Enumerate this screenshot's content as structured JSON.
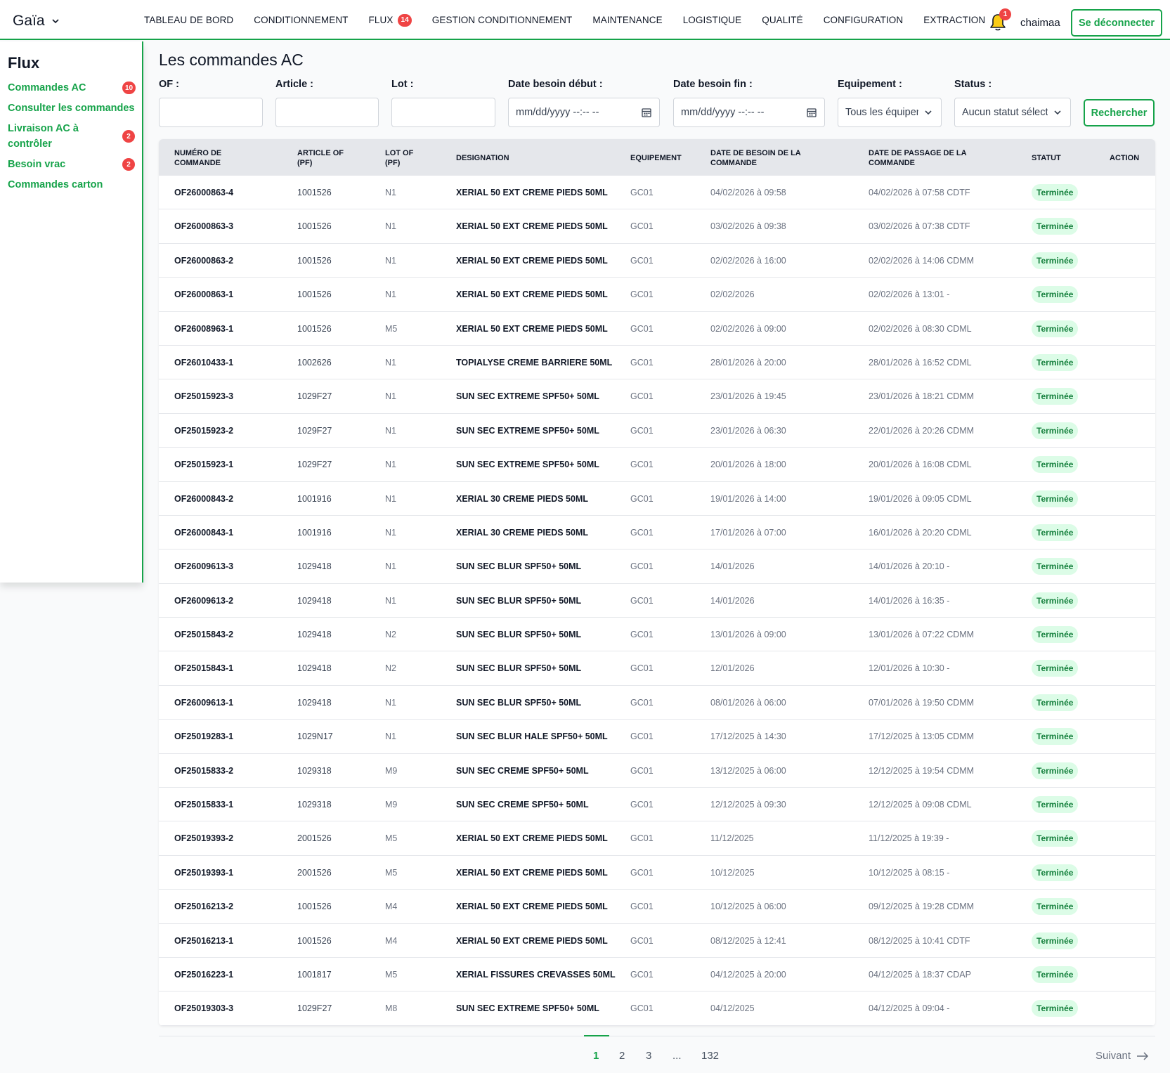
{
  "app": {
    "brand": "Gaïa"
  },
  "colors": {
    "accent": "#16a34a",
    "badge": "#ef4444",
    "status_bg": "#dcfce7",
    "status_text": "#15803d"
  },
  "nav": [
    {
      "label": "TABLEAU DE BORD"
    },
    {
      "label": "CONDITIONNEMENT"
    },
    {
      "label": "FLUX",
      "badge": "14"
    },
    {
      "label": "GESTION CONDITIONNEMENT"
    },
    {
      "label": "MAINTENANCE"
    },
    {
      "label": "LOGISTIQUE"
    },
    {
      "label": "QUALITÉ"
    },
    {
      "label": "CONFIGURATION"
    },
    {
      "label": "EXTRACTION"
    }
  ],
  "header": {
    "notification_icon": "bell-icon",
    "notifications_count": "1",
    "username": "chaimaa",
    "logout_label": "Se déconnecter"
  },
  "sidebar": {
    "title": "Flux",
    "items": [
      {
        "label": "Commandes AC",
        "badge": "10"
      },
      {
        "label": "Consulter les commandes",
        "badge": ""
      },
      {
        "label": "Livraison AC à contrôler",
        "badge": "2"
      },
      {
        "label": "Besoin vrac",
        "badge": "2"
      },
      {
        "label": "Commandes carton",
        "badge": ""
      }
    ]
  },
  "main": {
    "title": "Les commandes AC"
  },
  "filters": {
    "of_label": "OF :",
    "article_label": "Article :",
    "lot_label": "Lot :",
    "date_start_label": "Date besoin début :",
    "date_start_placeholder": "mm/dd/yyyy --:-- --",
    "date_end_label": "Date besoin fin :",
    "date_end_placeholder": "mm/dd/yyyy --:-- --",
    "equipment_label": "Equipement :",
    "equipment_value": "Tous les équipements",
    "status_label": "Status :",
    "status_value": "Aucun statut sélectionné",
    "search_label": "Rechercher"
  },
  "table": {
    "headers": {
      "num_l1": "NUMÉRO DE",
      "num_l2": "COMMANDE",
      "art_l1": "ARTICLE OF",
      "art_l2": "(PF)",
      "lot_l1": "LOT OF",
      "lot_l2": "(PF)",
      "des": "DESIGNATION",
      "eq": "EQUIPEMENT",
      "db_l1": "DATE DE BESOIN DE LA",
      "db_l2": "COMMANDE",
      "dp_l1": "DATE DE PASSAGE DE LA",
      "dp_l2": "COMMANDE",
      "status": "STATUT",
      "action": "ACTION"
    },
    "rows": [
      [
        "OF26000863-4",
        "1001526",
        "N1",
        "XERIAL 50 EXT CREME PIEDS 50ML",
        "GC01",
        "04/02/2026 à 09:58",
        "04/02/2026 à 07:58 CDTF",
        "Terminée"
      ],
      [
        "OF26000863-3",
        "1001526",
        "N1",
        "XERIAL 50 EXT CREME PIEDS 50ML",
        "GC01",
        "03/02/2026 à 09:38",
        "03/02/2026 à 07:38 CDTF",
        "Terminée"
      ],
      [
        "OF26000863-2",
        "1001526",
        "N1",
        "XERIAL 50 EXT CREME PIEDS 50ML",
        "GC01",
        "02/02/2026 à 16:00",
        "02/02/2026 à 14:06 CDMM",
        "Terminée"
      ],
      [
        "OF26000863-1",
        "1001526",
        "N1",
        "XERIAL 50 EXT CREME PIEDS 50ML",
        "GC01",
        "02/02/2026",
        "02/02/2026 à 13:01 -",
        "Terminée"
      ],
      [
        "OF26008963-1",
        "1001526",
        "M5",
        "XERIAL 50 EXT CREME PIEDS 50ML",
        "GC01",
        "02/02/2026 à 09:00",
        "02/02/2026 à 08:30 CDML",
        "Terminée"
      ],
      [
        "OF26010433-1",
        "1002626",
        "N1",
        "TOPIALYSE CREME BARRIERE 50ML",
        "GC01",
        "28/01/2026 à 20:00",
        "28/01/2026 à 16:52 CDML",
        "Terminée"
      ],
      [
        "OF25015923-3",
        "1029F27",
        "N1",
        "SUN SEC EXTREME SPF50+ 50ML",
        "GC01",
        "23/01/2026 à 19:45",
        "23/01/2026 à 18:21 CDMM",
        "Terminée"
      ],
      [
        "OF25015923-2",
        "1029F27",
        "N1",
        "SUN SEC EXTREME SPF50+ 50ML",
        "GC01",
        "23/01/2026 à 06:30",
        "22/01/2026 à 20:26 CDMM",
        "Terminée"
      ],
      [
        "OF25015923-1",
        "1029F27",
        "N1",
        "SUN SEC EXTREME SPF50+ 50ML",
        "GC01",
        "20/01/2026 à 18:00",
        "20/01/2026 à 16:08 CDML",
        "Terminée"
      ],
      [
        "OF26000843-2",
        "1001916",
        "N1",
        "XERIAL 30 CREME PIEDS 50ML",
        "GC01",
        "19/01/2026 à 14:00",
        "19/01/2026 à 09:05 CDML",
        "Terminée"
      ],
      [
        "OF26000843-1",
        "1001916",
        "N1",
        "XERIAL 30 CREME PIEDS 50ML",
        "GC01",
        "17/01/2026 à 07:00",
        "16/01/2026 à 20:20 CDML",
        "Terminée"
      ],
      [
        "OF26009613-3",
        "1029418",
        "N1",
        "SUN SEC BLUR SPF50+ 50ML",
        "GC01",
        "14/01/2026",
        "14/01/2026 à 20:10 -",
        "Terminée"
      ],
      [
        "OF26009613-2",
        "1029418",
        "N1",
        "SUN SEC BLUR SPF50+ 50ML",
        "GC01",
        "14/01/2026",
        "14/01/2026 à 16:35 -",
        "Terminée"
      ],
      [
        "OF25015843-2",
        "1029418",
        "N2",
        "SUN SEC BLUR SPF50+ 50ML",
        "GC01",
        "13/01/2026 à 09:00",
        "13/01/2026 à 07:22 CDMM",
        "Terminée"
      ],
      [
        "OF25015843-1",
        "1029418",
        "N2",
        "SUN SEC BLUR SPF50+ 50ML",
        "GC01",
        "12/01/2026",
        "12/01/2026 à 10:30 -",
        "Terminée"
      ],
      [
        "OF26009613-1",
        "1029418",
        "N1",
        "SUN SEC BLUR SPF50+ 50ML",
        "GC01",
        "08/01/2026 à 06:00",
        "07/01/2026 à 19:50 CDMM",
        "Terminée"
      ],
      [
        "OF25019283-1",
        "1029N17",
        "N1",
        "SUN SEC BLUR HALE SPF50+ 50ML",
        "GC01",
        "17/12/2025 à 14:30",
        "17/12/2025 à 13:05 CDMM",
        "Terminée"
      ],
      [
        "OF25015833-2",
        "1029318",
        "M9",
        "SUN SEC CREME SPF50+ 50ML",
        "GC01",
        "13/12/2025 à 06:00",
        "12/12/2025 à 19:54 CDMM",
        "Terminée"
      ],
      [
        "OF25015833-1",
        "1029318",
        "M9",
        "SUN SEC CREME SPF50+ 50ML",
        "GC01",
        "12/12/2025 à 09:30",
        "12/12/2025 à 09:08 CDML",
        "Terminée"
      ],
      [
        "OF25019393-2",
        "2001526",
        "M5",
        "XERIAL 50 EXT CREME PIEDS 50ML",
        "GC01",
        "11/12/2025",
        "11/12/2025 à 19:39 -",
        "Terminée"
      ],
      [
        "OF25019393-1",
        "2001526",
        "M5",
        "XERIAL 50 EXT CREME PIEDS 50ML",
        "GC01",
        "10/12/2025",
        "10/12/2025 à 08:15 -",
        "Terminée"
      ],
      [
        "OF25016213-2",
        "1001526",
        "M4",
        "XERIAL 50 EXT CREME PIEDS 50ML",
        "GC01",
        "10/12/2025 à 06:00",
        "09/12/2025 à 19:28 CDMM",
        "Terminée"
      ],
      [
        "OF25016213-1",
        "1001526",
        "M4",
        "XERIAL 50 EXT CREME PIEDS 50ML",
        "GC01",
        "08/12/2025 à 12:41",
        "08/12/2025 à 10:41 CDTF",
        "Terminée"
      ],
      [
        "OF25016223-1",
        "1001817",
        "M5",
        "XERIAL FISSURES CREVASSES 50ML",
        "GC01",
        "04/12/2025 à 20:00",
        "04/12/2025 à 18:37 CDAP",
        "Terminée"
      ],
      [
        "OF25019303-3",
        "1029F27",
        "M8",
        "SUN SEC EXTREME SPF50+ 50ML",
        "GC01",
        "04/12/2025",
        "04/12/2025 à 09:04 -",
        "Terminée"
      ]
    ]
  },
  "pagination": {
    "pages": [
      "1",
      "2",
      "3",
      "...",
      "132"
    ],
    "current": "1",
    "next_label": "Suivant"
  }
}
